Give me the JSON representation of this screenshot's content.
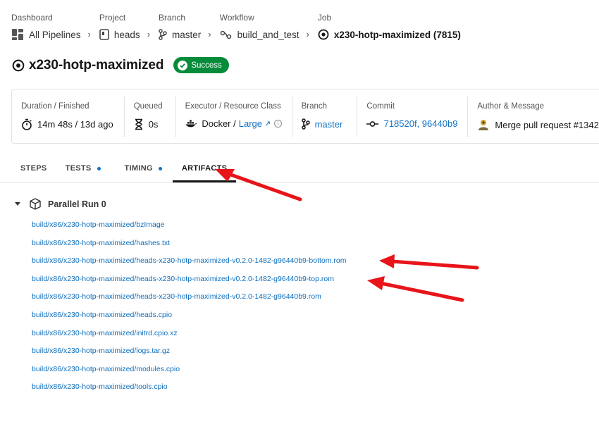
{
  "breadcrumb": [
    {
      "caption": "Dashboard",
      "value": "All Pipelines",
      "icon": "pipelines-grid-icon"
    },
    {
      "caption": "Project",
      "value": "heads",
      "icon": "project-icon"
    },
    {
      "caption": "Branch",
      "value": "master",
      "icon": "branch-icon"
    },
    {
      "caption": "Workflow",
      "value": "build_and_test",
      "icon": "workflow-icon"
    },
    {
      "caption": "Job",
      "value": "x230-hotp-maximized (7815)",
      "icon": "job-icon"
    }
  ],
  "job": {
    "title": "x230-hotp-maximized",
    "status": "Success",
    "status_color": "#058b3a"
  },
  "info": {
    "duration": {
      "label": "Duration / Finished",
      "value": "14m 48s / 13d ago"
    },
    "queued": {
      "label": "Queued",
      "value": "0s"
    },
    "executor": {
      "label": "Executor / Resource Class",
      "value": "Docker / ",
      "resource_class": "Large"
    },
    "branch": {
      "label": "Branch",
      "value": "master"
    },
    "commit": {
      "label": "Commit",
      "value": "718520f, 96440b9"
    },
    "author": {
      "label": "Author & Message",
      "value": "Merge pull request #1342"
    }
  },
  "tabs": [
    {
      "label": "STEPS",
      "dot": false,
      "active": false
    },
    {
      "label": "TESTS",
      "dot": true,
      "active": false
    },
    {
      "label": "TIMING",
      "dot": true,
      "active": false
    },
    {
      "label": "ARTIFACTS",
      "dot": false,
      "active": true
    }
  ],
  "artifacts": {
    "run_label": "Parallel Run 0",
    "files": [
      "build/x86/x230-hotp-maximized/bzImage",
      "build/x86/x230-hotp-maximized/hashes.txt",
      "build/x86/x230-hotp-maximized/heads-x230-hotp-maximized-v0.2.0-1482-g96440b9-bottom.rom",
      "build/x86/x230-hotp-maximized/heads-x230-hotp-maximized-v0.2.0-1482-g96440b9-top.rom",
      "build/x86/x230-hotp-maximized/heads-x230-hotp-maximized-v0.2.0-1482-g96440b9.rom",
      "build/x86/x230-hotp-maximized/heads.cpio",
      "build/x86/x230-hotp-maximized/initrd.cpio.xz",
      "build/x86/x230-hotp-maximized/logs.tar.gz",
      "build/x86/x230-hotp-maximized/modules.cpio",
      "build/x86/x230-hotp-maximized/tools.cpio"
    ]
  },
  "colors": {
    "link": "#0f6fbd",
    "annotation_arrow": "#e8141a"
  }
}
